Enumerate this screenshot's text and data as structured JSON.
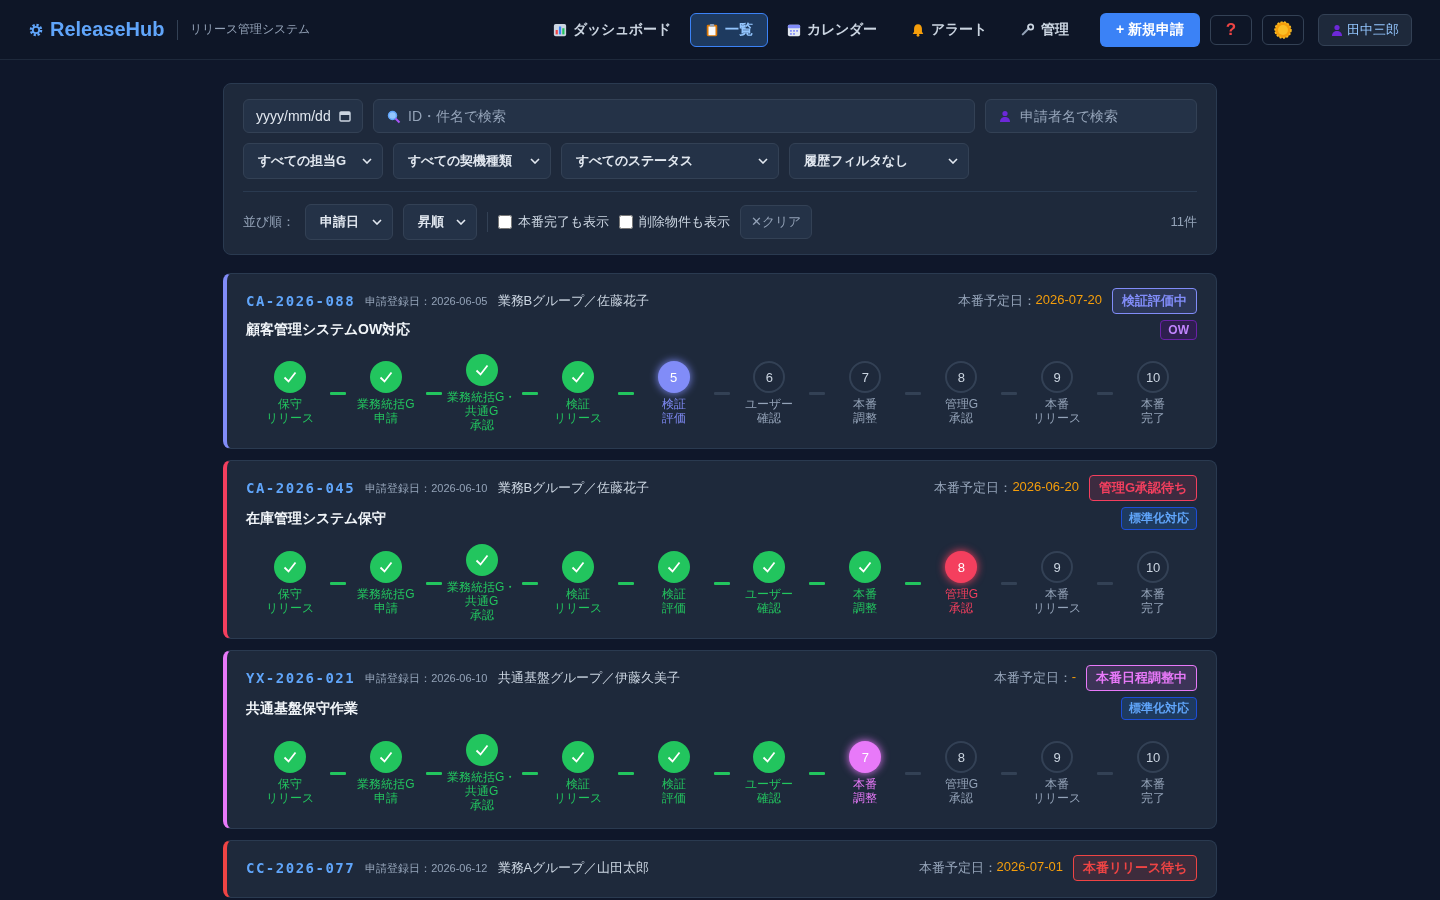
{
  "header": {
    "logo": "ReleaseHub",
    "subtitle": "リリース管理システム",
    "nav": [
      {
        "label": "ダッシュボード",
        "selected": false
      },
      {
        "label": "一覧",
        "selected": true
      },
      {
        "label": "カレンダー",
        "selected": false
      },
      {
        "label": "アラート",
        "selected": false
      },
      {
        "label": "管理",
        "selected": false
      }
    ],
    "new_button": "+ 新規申請",
    "help_button": "?",
    "user": "田中三郎"
  },
  "filters": {
    "date": {
      "placeholder": "yyyy/mm/dd"
    },
    "search": {
      "placeholder": "ID・件名で検索"
    },
    "applicant": {
      "placeholder": "申請者名で検索"
    },
    "selects": [
      "すべての担当G",
      "すべての契機種類",
      "すべてのステータス",
      "履歴フィルタなし"
    ],
    "sort_label": "並び順：",
    "sort_key": "申請日",
    "sort_order": "昇順",
    "checkboxes": [
      {
        "label": "本番完了も表示",
        "checked": false
      },
      {
        "label": "削除物件も表示",
        "checked": false
      }
    ],
    "clear_button": "✕クリア",
    "count": "11件"
  },
  "cards": [
    {
      "id": "CA-2026-088",
      "registered": "申請登録日：2026-06-05",
      "group": "業務Bグループ／佐藤花子",
      "due_label": "本番予定日：",
      "due": "2026-07-20",
      "status": "検証評価中",
      "color": "#818cf8",
      "title": "顧客管理システムOW対応",
      "tag": {
        "label": "OW",
        "kind": "ow"
      },
      "steps": [
        {
          "label": [
            "保守",
            "リリース"
          ],
          "done": true,
          "current": false
        },
        {
          "label": [
            "業務統括G",
            "申請"
          ],
          "done": true,
          "current": false
        },
        {
          "label": [
            "業務統括G・共通G",
            "承認"
          ],
          "done": true,
          "current": false
        },
        {
          "label": [
            "検証",
            "リリース"
          ],
          "done": true,
          "current": false
        },
        {
          "number": "5",
          "label": [
            "検証",
            "評価"
          ],
          "done": false,
          "current": true
        },
        {
          "number": "6",
          "label": [
            "ユーザー",
            "確認"
          ],
          "done": false,
          "current": false
        },
        {
          "number": "7",
          "label": [
            "本番",
            "調整"
          ],
          "done": false,
          "current": false
        },
        {
          "number": "8",
          "label": [
            "管理G",
            "承認"
          ],
          "done": false,
          "current": false
        },
        {
          "number": "9",
          "label": [
            "本番",
            "リリース"
          ],
          "done": false,
          "current": false
        },
        {
          "number": "10",
          "label": [
            "本番",
            "完了"
          ],
          "done": false,
          "current": false
        }
      ]
    },
    {
      "id": "CA-2026-045",
      "registered": "申請登録日：2026-06-10",
      "group": "業務Bグループ／佐藤花子",
      "due_label": "本番予定日：",
      "due": "2026-06-20",
      "status": "管理G承認待ち",
      "color": "#f43f5e",
      "title": "在庫管理システム保守",
      "tag": {
        "label": "標準化対応",
        "kind": "standard"
      },
      "steps": [
        {
          "label": [
            "保守",
            "リリース"
          ],
          "done": true,
          "current": false
        },
        {
          "label": [
            "業務統括G",
            "申請"
          ],
          "done": true,
          "current": false
        },
        {
          "label": [
            "業務統括G・共通G",
            "承認"
          ],
          "done": true,
          "current": false
        },
        {
          "label": [
            "検証",
            "リリース"
          ],
          "done": true,
          "current": false
        },
        {
          "label": [
            "検証",
            "評価"
          ],
          "done": true,
          "current": false
        },
        {
          "label": [
            "ユーザー",
            "確認"
          ],
          "done": true,
          "current": false
        },
        {
          "label": [
            "本番",
            "調整"
          ],
          "done": true,
          "current": false
        },
        {
          "number": "8",
          "label": [
            "管理G",
            "承認"
          ],
          "done": false,
          "current": true
        },
        {
          "number": "9",
          "label": [
            "本番",
            "リリース"
          ],
          "done": false,
          "current": false
        },
        {
          "number": "10",
          "label": [
            "本番",
            "完了"
          ],
          "done": false,
          "current": false
        }
      ]
    },
    {
      "id": "YX-2026-021",
      "registered": "申請登録日：2026-06-10",
      "group": "共通基盤グループ／伊藤久美子",
      "due_label": "本番予定日：",
      "due": "-",
      "status": "本番日程調整中",
      "color": "#e879f9",
      "title": "共通基盤保守作業",
      "tag": {
        "label": "標準化対応",
        "kind": "standard"
      },
      "steps": [
        {
          "label": [
            "保守",
            "リリース"
          ],
          "done": true,
          "current": false
        },
        {
          "label": [
            "業務統括G",
            "申請"
          ],
          "done": true,
          "current": false
        },
        {
          "label": [
            "業務統括G・共通G",
            "承認"
          ],
          "done": true,
          "current": false
        },
        {
          "label": [
            "検証",
            "リリース"
          ],
          "done": true,
          "current": false
        },
        {
          "label": [
            "検証",
            "評価"
          ],
          "done": true,
          "current": false
        },
        {
          "label": [
            "ユーザー",
            "確認"
          ],
          "done": true,
          "current": false
        },
        {
          "number": "7",
          "label": [
            "本番",
            "調整"
          ],
          "done": false,
          "current": true
        },
        {
          "number": "8",
          "label": [
            "管理G",
            "承認"
          ],
          "done": false,
          "current": false
        },
        {
          "number": "9",
          "label": [
            "本番",
            "リリース"
          ],
          "done": false,
          "current": false
        },
        {
          "number": "10",
          "label": [
            "本番",
            "完了"
          ],
          "done": false,
          "current": false
        }
      ]
    },
    {
      "id": "CC-2026-077",
      "registered": "申請登録日：2026-06-12",
      "group": "業務Aグループ／山田太郎",
      "due_label": "本番予定日：",
      "due": "2026-07-01",
      "status": "本番リリース待ち",
      "color": "#ef4444"
    }
  ]
}
